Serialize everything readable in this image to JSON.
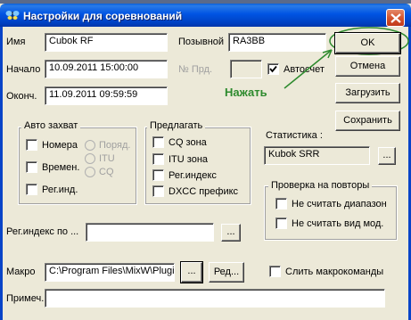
{
  "window": {
    "title": "Настройки для соревнований"
  },
  "fields": {
    "name_label": "Имя",
    "name_value": "Cubok RF",
    "callsign_label": "Позывной",
    "callsign_value": "RA3BB",
    "start_label": "Начало",
    "start_value": "10.09.2011 15:00:00",
    "end_label": "Оконч.",
    "end_value": "11.09.2011 09:59:59",
    "serial_label": "№ Прд.",
    "serial_value": "",
    "autoreport_label": "Автосчет",
    "autoreport_checked": true
  },
  "buttons": {
    "ok": "OK",
    "cancel": "Отмена",
    "load": "Загрузить",
    "save": "Сохранить",
    "browse": "...",
    "edit": "Ред..."
  },
  "annotation": {
    "text": "Нажать",
    "color": "#2d8a2d"
  },
  "autocapture": {
    "title": "Авто захват",
    "numbers": "Номера",
    "time": "Времен.",
    "region": "Рег.инд.",
    "order": "Поряд.",
    "itu": "ITU",
    "cq": "CQ"
  },
  "suggest": {
    "title": "Предлагать",
    "cq_zone": "CQ зона",
    "itu_zone": "ITU зона",
    "region_index": "Рег.индекс",
    "dxcc_prefix": "DXCC префикс"
  },
  "statistics": {
    "label": "Статистика :",
    "value": "Kubok SRR"
  },
  "dupe_check": {
    "title": "Проверка на повторы",
    "ignore_band": "Не считать диапазон",
    "ignore_mode": "Не считать вид мод."
  },
  "region_by": {
    "label": "Рег.индекс по ...",
    "value": ""
  },
  "macro": {
    "label": "Макро",
    "value": "C:\\Program Files\\MixW\\Plugi",
    "merge_label": "Слить макрокоманды"
  },
  "note": {
    "label": "Примеч.",
    "value": ""
  }
}
